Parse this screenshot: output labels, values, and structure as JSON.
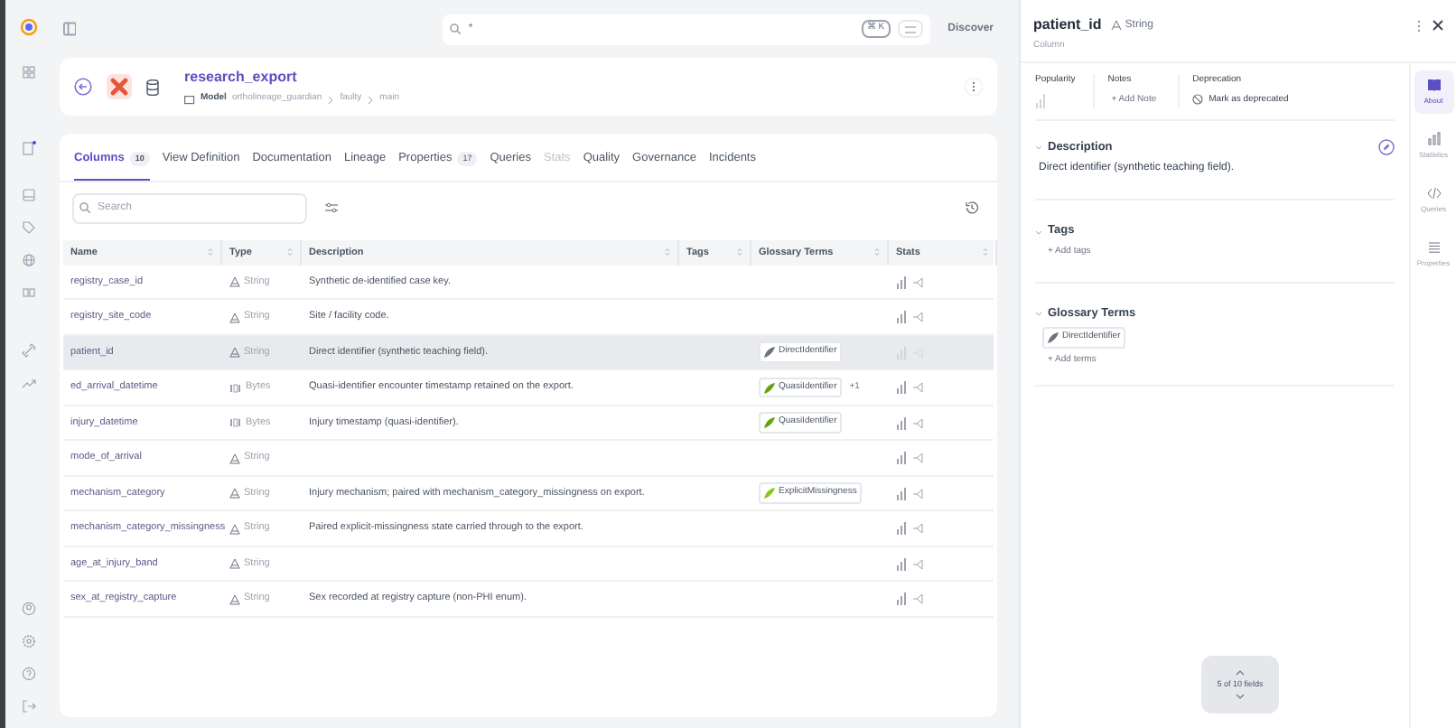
{
  "topbar": {
    "search_value": "*",
    "shortcut": "⌘ K",
    "nav": "Discover"
  },
  "entity": {
    "title": "research_export",
    "kind": "Model",
    "breadcrumb": [
      "ortholineage_guardian",
      "faulty",
      "main"
    ]
  },
  "tabs": [
    {
      "label": "Columns",
      "count": "10",
      "selected": true,
      "disabled": false
    },
    {
      "label": "View Definition",
      "selected": false,
      "disabled": false
    },
    {
      "label": "Documentation",
      "selected": false,
      "disabled": false
    },
    {
      "label": "Lineage",
      "selected": false,
      "disabled": false
    },
    {
      "label": "Properties",
      "count": "17",
      "selected": false,
      "disabled": false
    },
    {
      "label": "Queries",
      "selected": false,
      "disabled": false
    },
    {
      "label": "Stats",
      "selected": false,
      "disabled": true
    },
    {
      "label": "Quality",
      "selected": false,
      "disabled": false
    },
    {
      "label": "Governance",
      "selected": false,
      "disabled": false
    },
    {
      "label": "Incidents",
      "selected": false,
      "disabled": false
    }
  ],
  "table": {
    "search_placeholder": "Search",
    "columns": [
      "Name",
      "Type",
      "Description",
      "Tags",
      "Glossary Terms",
      "Stats"
    ],
    "rows": [
      {
        "name": "registry_case_id",
        "type": "String",
        "kind": "string",
        "description": "Synthetic de-identified case key.",
        "terms": [],
        "selected": false
      },
      {
        "name": "registry_site_code",
        "type": "String",
        "kind": "string",
        "description": "Site / facility code.",
        "terms": [],
        "selected": false
      },
      {
        "name": "patient_id",
        "type": "String",
        "kind": "string",
        "description": "Direct identifier (synthetic teaching field).",
        "terms": [
          {
            "label": "DirectIdentifier",
            "color": "#6b7280"
          }
        ],
        "selected": true
      },
      {
        "name": "ed_arrival_datetime",
        "type": "Bytes",
        "kind": "bytes",
        "description": "Quasi-identifier encounter timestamp retained on the export.",
        "terms": [
          {
            "label": "QuasiIdentifier",
            "color": "#65a30d"
          }
        ],
        "more": "+1",
        "selected": false
      },
      {
        "name": "injury_datetime",
        "type": "Bytes",
        "kind": "bytes",
        "description": "Injury timestamp (quasi-identifier).",
        "terms": [
          {
            "label": "QuasiIdentifier",
            "color": "#65a30d"
          }
        ],
        "selected": false
      },
      {
        "name": "mode_of_arrival",
        "type": "String",
        "kind": "string",
        "terms": [],
        "selected": false
      },
      {
        "name": "mechanism_category",
        "type": "String",
        "kind": "string",
        "description": "Injury mechanism; paired with mechanism_category_missingness on export.",
        "terms": [
          {
            "label": "ExplicitMissingness",
            "color": "#84cc16"
          }
        ],
        "selected": false
      },
      {
        "name": "mechanism_category_missingness",
        "type": "String",
        "kind": "string",
        "description": "Paired explicit-missingness state carried through to the export.",
        "terms": [],
        "selected": false
      },
      {
        "name": "age_at_injury_band",
        "type": "String",
        "kind": "string",
        "terms": [],
        "selected": false
      },
      {
        "name": "sex_at_registry_capture",
        "type": "String",
        "kind": "string",
        "description": "Sex recorded at registry capture (non-PHI enum).",
        "terms": [],
        "selected": false
      }
    ]
  },
  "panel": {
    "title": "patient_id",
    "type": "String",
    "subtitle": "Column",
    "popularity_label": "Popularity",
    "notes_label": "Notes",
    "add_note": "+ Add Note",
    "deprecation_label": "Deprecation",
    "deprecate": "Mark as deprecated",
    "description_heading": "Description",
    "description": "Direct identifier (synthetic teaching field).",
    "tags_heading": "Tags",
    "add_tags": "+ Add tags",
    "glossary_heading": "Glossary Terms",
    "terms": [
      {
        "label": "DirectIdentifier",
        "color": "#6b7280"
      }
    ],
    "add_terms": "+ Add terms",
    "pager": "5 of 10 fields",
    "rail": [
      {
        "label": "About",
        "kind": "book",
        "selected": true
      },
      {
        "label": "Statistics",
        "kind": "chart",
        "selected": false
      },
      {
        "label": "Queries",
        "kind": "code",
        "selected": false
      },
      {
        "label": "Properties",
        "kind": "list",
        "selected": false
      }
    ]
  }
}
